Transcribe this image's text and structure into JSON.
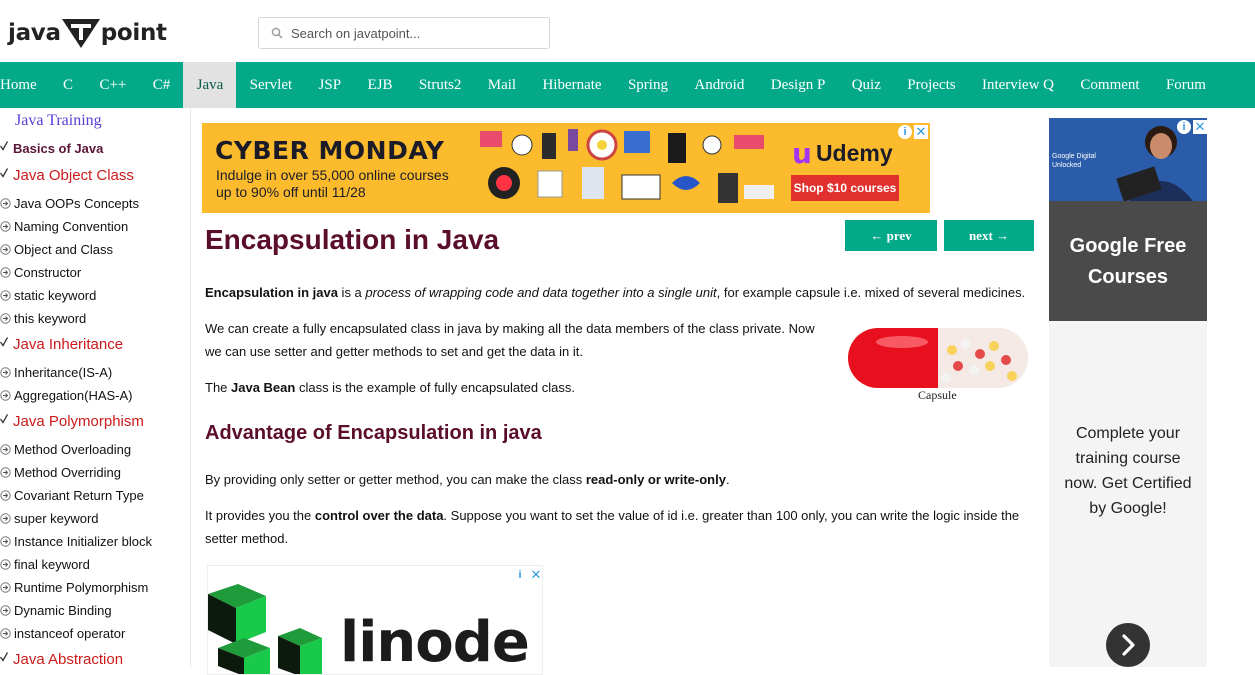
{
  "site": {
    "logo_left": "java",
    "logo_right": "point"
  },
  "search": {
    "placeholder": "Search on javatpoint..."
  },
  "nav": {
    "items": [
      "Home",
      "C",
      "C++",
      "C#",
      "Java",
      "Servlet",
      "JSP",
      "EJB",
      "Struts2",
      "Mail",
      "Hibernate",
      "Spring",
      "Android",
      "Design P",
      "Quiz",
      "Projects",
      "Interview Q",
      "Comment",
      "Forum"
    ],
    "active": "Java"
  },
  "sidebar": {
    "title": "Java Training",
    "basics": "Basics of Java",
    "sections": [
      {
        "title": "Java Object Class",
        "items": [
          "Java OOPs Concepts",
          "Naming Convention",
          "Object and Class",
          "Constructor",
          "static keyword",
          "this keyword"
        ]
      },
      {
        "title": "Java Inheritance",
        "items": [
          "Inheritance(IS-A)",
          "Aggregation(HAS-A)"
        ]
      },
      {
        "title": "Java Polymorphism",
        "items": [
          "Method Overloading",
          "Method Overriding",
          "Covariant Return Type",
          "super keyword",
          "Instance Initializer block",
          "final keyword",
          "Runtime Polymorphism",
          "Dynamic Binding",
          "instanceof operator"
        ]
      },
      {
        "title": "Java Abstraction",
        "items": []
      }
    ]
  },
  "ad_top": {
    "headline": "CYBER MONDAY",
    "sub1": "Indulge in over 55,000 online courses",
    "sub2": "up to 90% off until 11/28",
    "brand": "Udemy",
    "cta": "Shop $10 courses"
  },
  "pager": {
    "prev": "← prev",
    "next": "next →"
  },
  "article": {
    "title": "Encapsulation in Java",
    "p1_bold": "Encapsulation in java",
    "p1_mid": " is a ",
    "p1_italic": "process of wrapping code and data together into a single unit",
    "p1_end": ", for example capsule i.e. mixed of several medicines.",
    "p2_line1": "We can create a fully encapsulated class in java by making all the data members of the class private. Now",
    "p2_line2": "we can use setter and getter methods to set and get the data in it.",
    "p3_start": "The ",
    "p3_bold": "Java Bean",
    "p3_end": " class is the example of fully encapsulated class.",
    "image_caption": "Capsule",
    "h2": "Advantage of Encapsulation in java",
    "p4_start": "By providing only setter or getter method, you can make the class ",
    "p4_bold": "read-only or write-only",
    "p4_end": ".",
    "p5_start": "It provides you the ",
    "p5_bold": "control over the data",
    "p5_line1_end": ". Suppose you want to set the value of id i.e. greater than 100 only, you can write the logic inside the",
    "p5_line2": "setter method."
  },
  "ad_linode": {
    "word": "linode"
  },
  "right_ad": {
    "img_text": "Google Digital Unlocked",
    "headline_1": "Google Free",
    "headline_2": "Courses",
    "body": [
      "Complete your",
      "training course",
      "now. Get Certified",
      "by Google!"
    ]
  },
  "colors": {
    "nav_bg": "#04a98a",
    "title": "#5a0e2b",
    "section_red": "#cc1b1b",
    "ad_yellow": "#fbbb2c"
  }
}
